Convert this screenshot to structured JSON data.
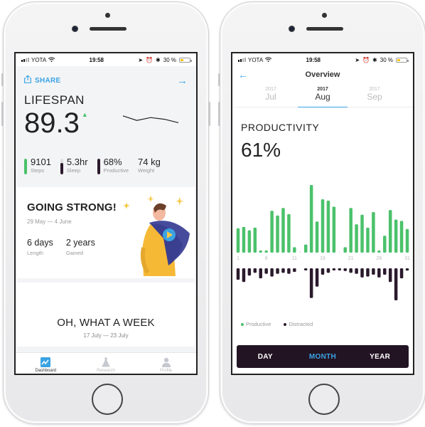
{
  "status_bar": {
    "carrier": "YOTA",
    "time": "19:58",
    "battery": "30 %"
  },
  "dashboard": {
    "share_label": "SHARE",
    "lifespan_title": "LIFESPAN",
    "lifespan_value": "89.3",
    "lifespan_trend": "up",
    "sparkline": [
      0.7,
      0.3,
      0.55,
      0.4,
      0.1
    ],
    "stats": [
      {
        "value": "9101",
        "label": "Steps",
        "fill": 1.0,
        "color": "#4bc16b"
      },
      {
        "value": "5.3hr",
        "label": "Sleep",
        "fill": 0.75,
        "color": "#2a1a2c"
      },
      {
        "value": "68%",
        "label": "Productive",
        "fill": 1.0,
        "color": "#2a1a2c"
      },
      {
        "value": "74 kg",
        "label": "Weight",
        "fill": 0,
        "color": "#2a1a2c"
      }
    ],
    "card_strong": {
      "title": "GOING STRONG!",
      "dates": "29 May — 4 June",
      "length_value": "6 days",
      "length_label": "Length",
      "gained_value": "2 years",
      "gained_label": "Gained"
    },
    "card_week": {
      "title": "OH, WHAT A WEEK",
      "dates": "17 July — 23 July"
    },
    "tabs": [
      {
        "label": "Dashboard",
        "icon": "chart-icon",
        "active": true
      },
      {
        "label": "Research",
        "icon": "flask-icon",
        "active": false
      },
      {
        "label": "Profile",
        "icon": "user-icon",
        "active": false
      }
    ]
  },
  "overview": {
    "title": "Overview",
    "months": [
      {
        "year": "2017",
        "month": "Jul",
        "active": false
      },
      {
        "year": "2017",
        "month": "Aug",
        "active": true
      },
      {
        "year": "2017",
        "month": "Sep",
        "active": false
      }
    ],
    "metric_title": "PRODUCTIVITY",
    "metric_value": "61%",
    "segments": [
      {
        "label": "DAY",
        "active": false
      },
      {
        "label": "MONTH",
        "active": true
      },
      {
        "label": "YEAR",
        "active": false
      }
    ]
  },
  "chart_data": {
    "type": "bar",
    "title": "PRODUCTIVITY",
    "x": [
      1,
      2,
      3,
      4,
      5,
      6,
      7,
      8,
      9,
      10,
      11,
      12,
      13,
      14,
      15,
      16,
      17,
      18,
      19,
      20,
      21,
      22,
      23,
      24,
      25,
      26,
      27,
      28,
      29,
      30,
      31
    ],
    "x_tick_labels": [
      "1",
      "6",
      "11",
      "16",
      "21",
      "26",
      "31"
    ],
    "colors": {
      "productive": "#4bc16b",
      "distracted": "#2a1a2c"
    },
    "series": [
      {
        "name": "Productive",
        "values": [
          36,
          38,
          33,
          37,
          1,
          1,
          62,
          55,
          66,
          57,
          8,
          0,
          12,
          100,
          46,
          79,
          77,
          68,
          0,
          8,
          66,
          42,
          56,
          37,
          60,
          1,
          25,
          63,
          49,
          47,
          35
        ]
      },
      {
        "name": "Distracted",
        "values": [
          25,
          30,
          16,
          10,
          22,
          12,
          18,
          12,
          10,
          12,
          8,
          0,
          4,
          65,
          40,
          14,
          10,
          4,
          3,
          6,
          10,
          12,
          20,
          18,
          14,
          20,
          14,
          30,
          70,
          22,
          5
        ]
      }
    ],
    "ylim": [
      0,
      100
    ],
    "legend": [
      "Productive",
      "Distracted"
    ],
    "legend_position": "bottom-left"
  }
}
